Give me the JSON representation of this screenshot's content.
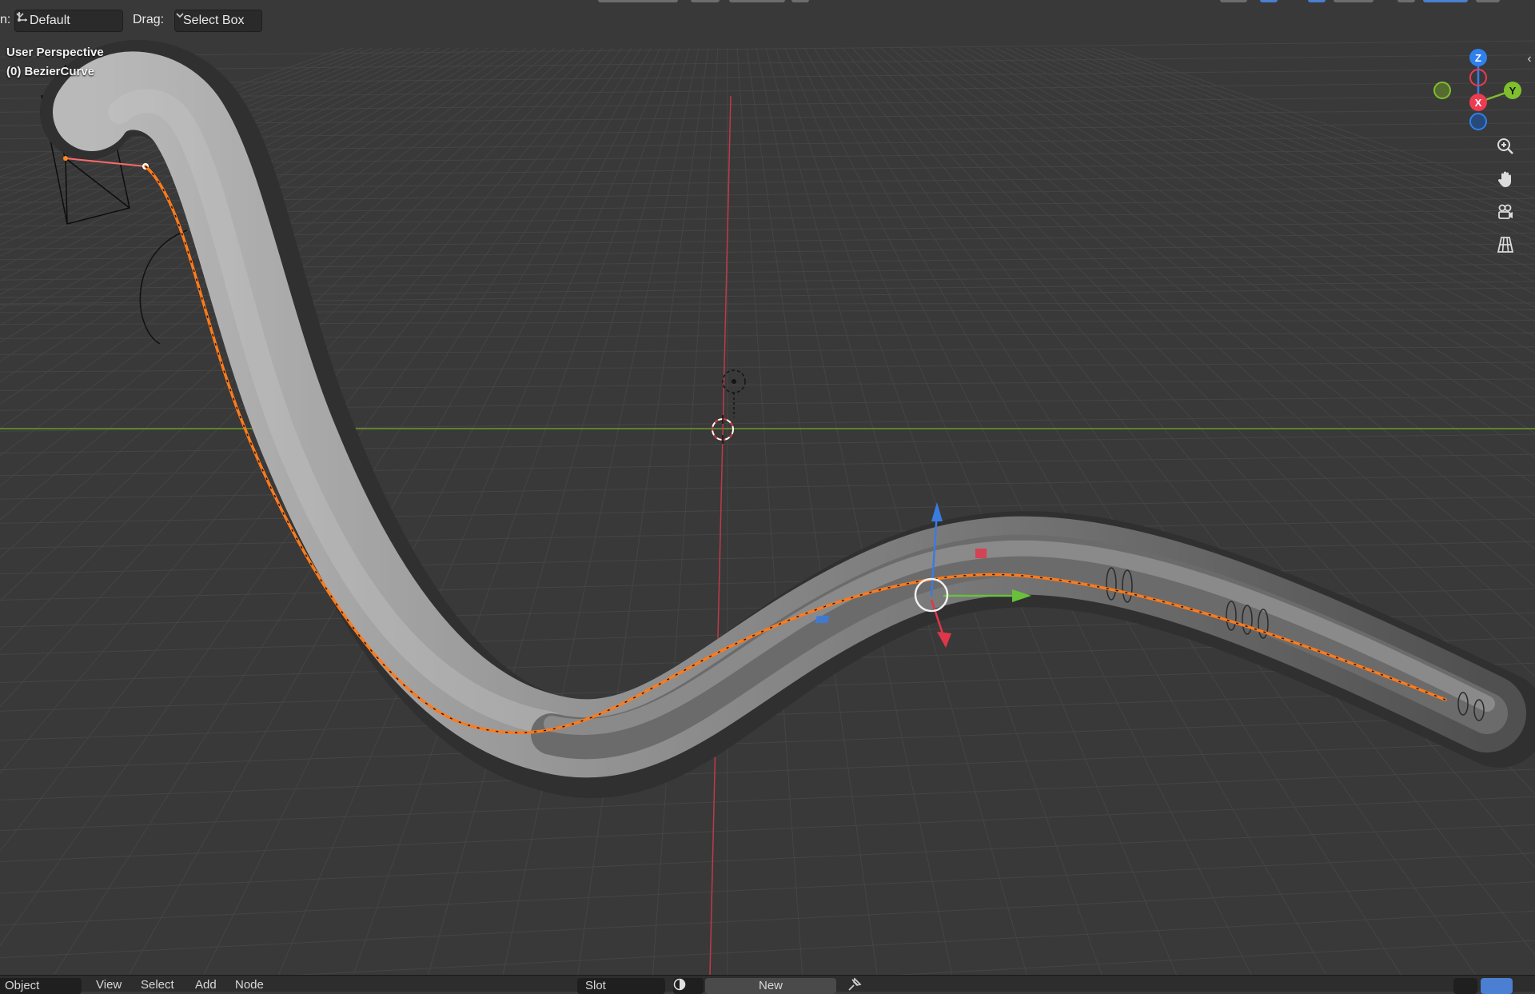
{
  "header": {
    "orientation_label": "n:",
    "orientation_value": "Default",
    "orientation_icon": "transform-orientation-icon",
    "drag_label": "Drag:",
    "drag_value": "Select Box",
    "chevron_icon": "chevron-down-icon"
  },
  "viewport": {
    "view_name": "User Perspective",
    "active_object": "(0) BezierCurve"
  },
  "navigation_gizmo": {
    "axes": [
      {
        "label": "Z",
        "color": "#2f80ed"
      },
      {
        "label": "X",
        "color": "#ed3b52"
      },
      {
        "label": "Y",
        "color": "#7fbf2e"
      },
      {
        "label": "",
        "color": "#7fbf2e"
      },
      {
        "label": "",
        "color": "#2f80ed"
      }
    ]
  },
  "nav_tools": [
    {
      "name": "zoom-icon"
    },
    {
      "name": "pan-hand-icon"
    },
    {
      "name": "camera-view-icon"
    },
    {
      "name": "perspective-grid-icon"
    }
  ],
  "bottom_bar": {
    "mode": "Object",
    "menus": [
      "View",
      "Select",
      "Add",
      "Node"
    ],
    "slot": "Slot",
    "new_button": "New"
  },
  "colors": {
    "background": "#393939",
    "grid": "#454545",
    "x_axis": "#c0394a",
    "y_axis": "#6a9a2a",
    "selection": "#ff7a1a",
    "curve_tube": "#8d8d8d"
  }
}
